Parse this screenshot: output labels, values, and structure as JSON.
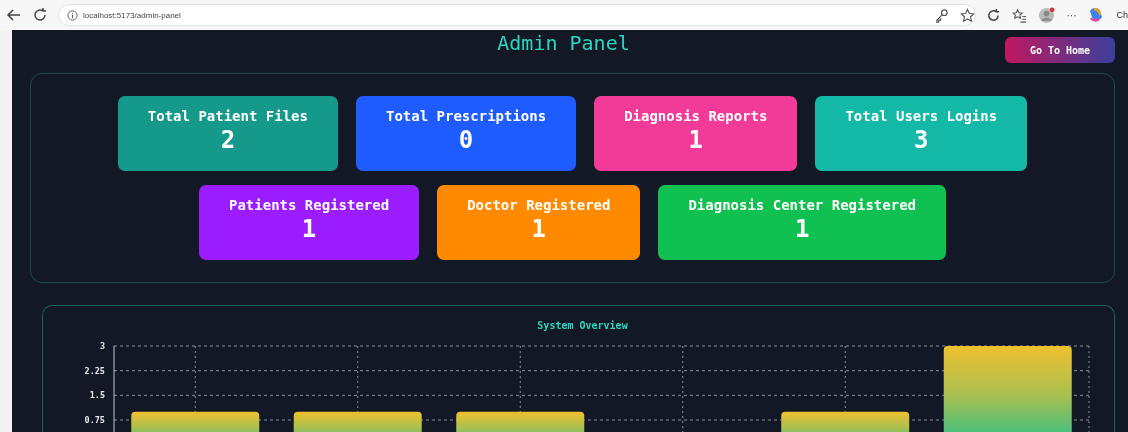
{
  "browser": {
    "url": "localhost:5173/admin-panel",
    "more": "···",
    "profile_label": "Ch"
  },
  "header": {
    "title": "Admin Panel",
    "home_button": "Go To Home"
  },
  "stat_rows": [
    [
      {
        "label": "Total Patient Files",
        "value": "2",
        "color": "#14998a"
      },
      {
        "label": "Total Prescriptions",
        "value": "0",
        "color": "#1e5cff"
      },
      {
        "label": "Diagnosis Reports",
        "value": "1",
        "color": "#f23a98"
      },
      {
        "label": "Total Users Logins",
        "value": "3",
        "color": "#14b8a6"
      }
    ],
    [
      {
        "label": "Patients Registered",
        "value": "1",
        "color": "#9b1cff"
      },
      {
        "label": "Doctor Registered",
        "value": "1",
        "color": "#ff8a00"
      },
      {
        "label": "Diagnosis Center Registered",
        "value": "1",
        "color": "#10c050"
      }
    ]
  ],
  "overview": {
    "title": "System Overview",
    "chart_data": {
      "type": "bar",
      "values": [
        1,
        1,
        1,
        0,
        1,
        3
      ],
      "ylim": [
        0,
        3
      ],
      "yticks": [
        0.75,
        1.5,
        2.25,
        3
      ],
      "grid": true
    }
  }
}
